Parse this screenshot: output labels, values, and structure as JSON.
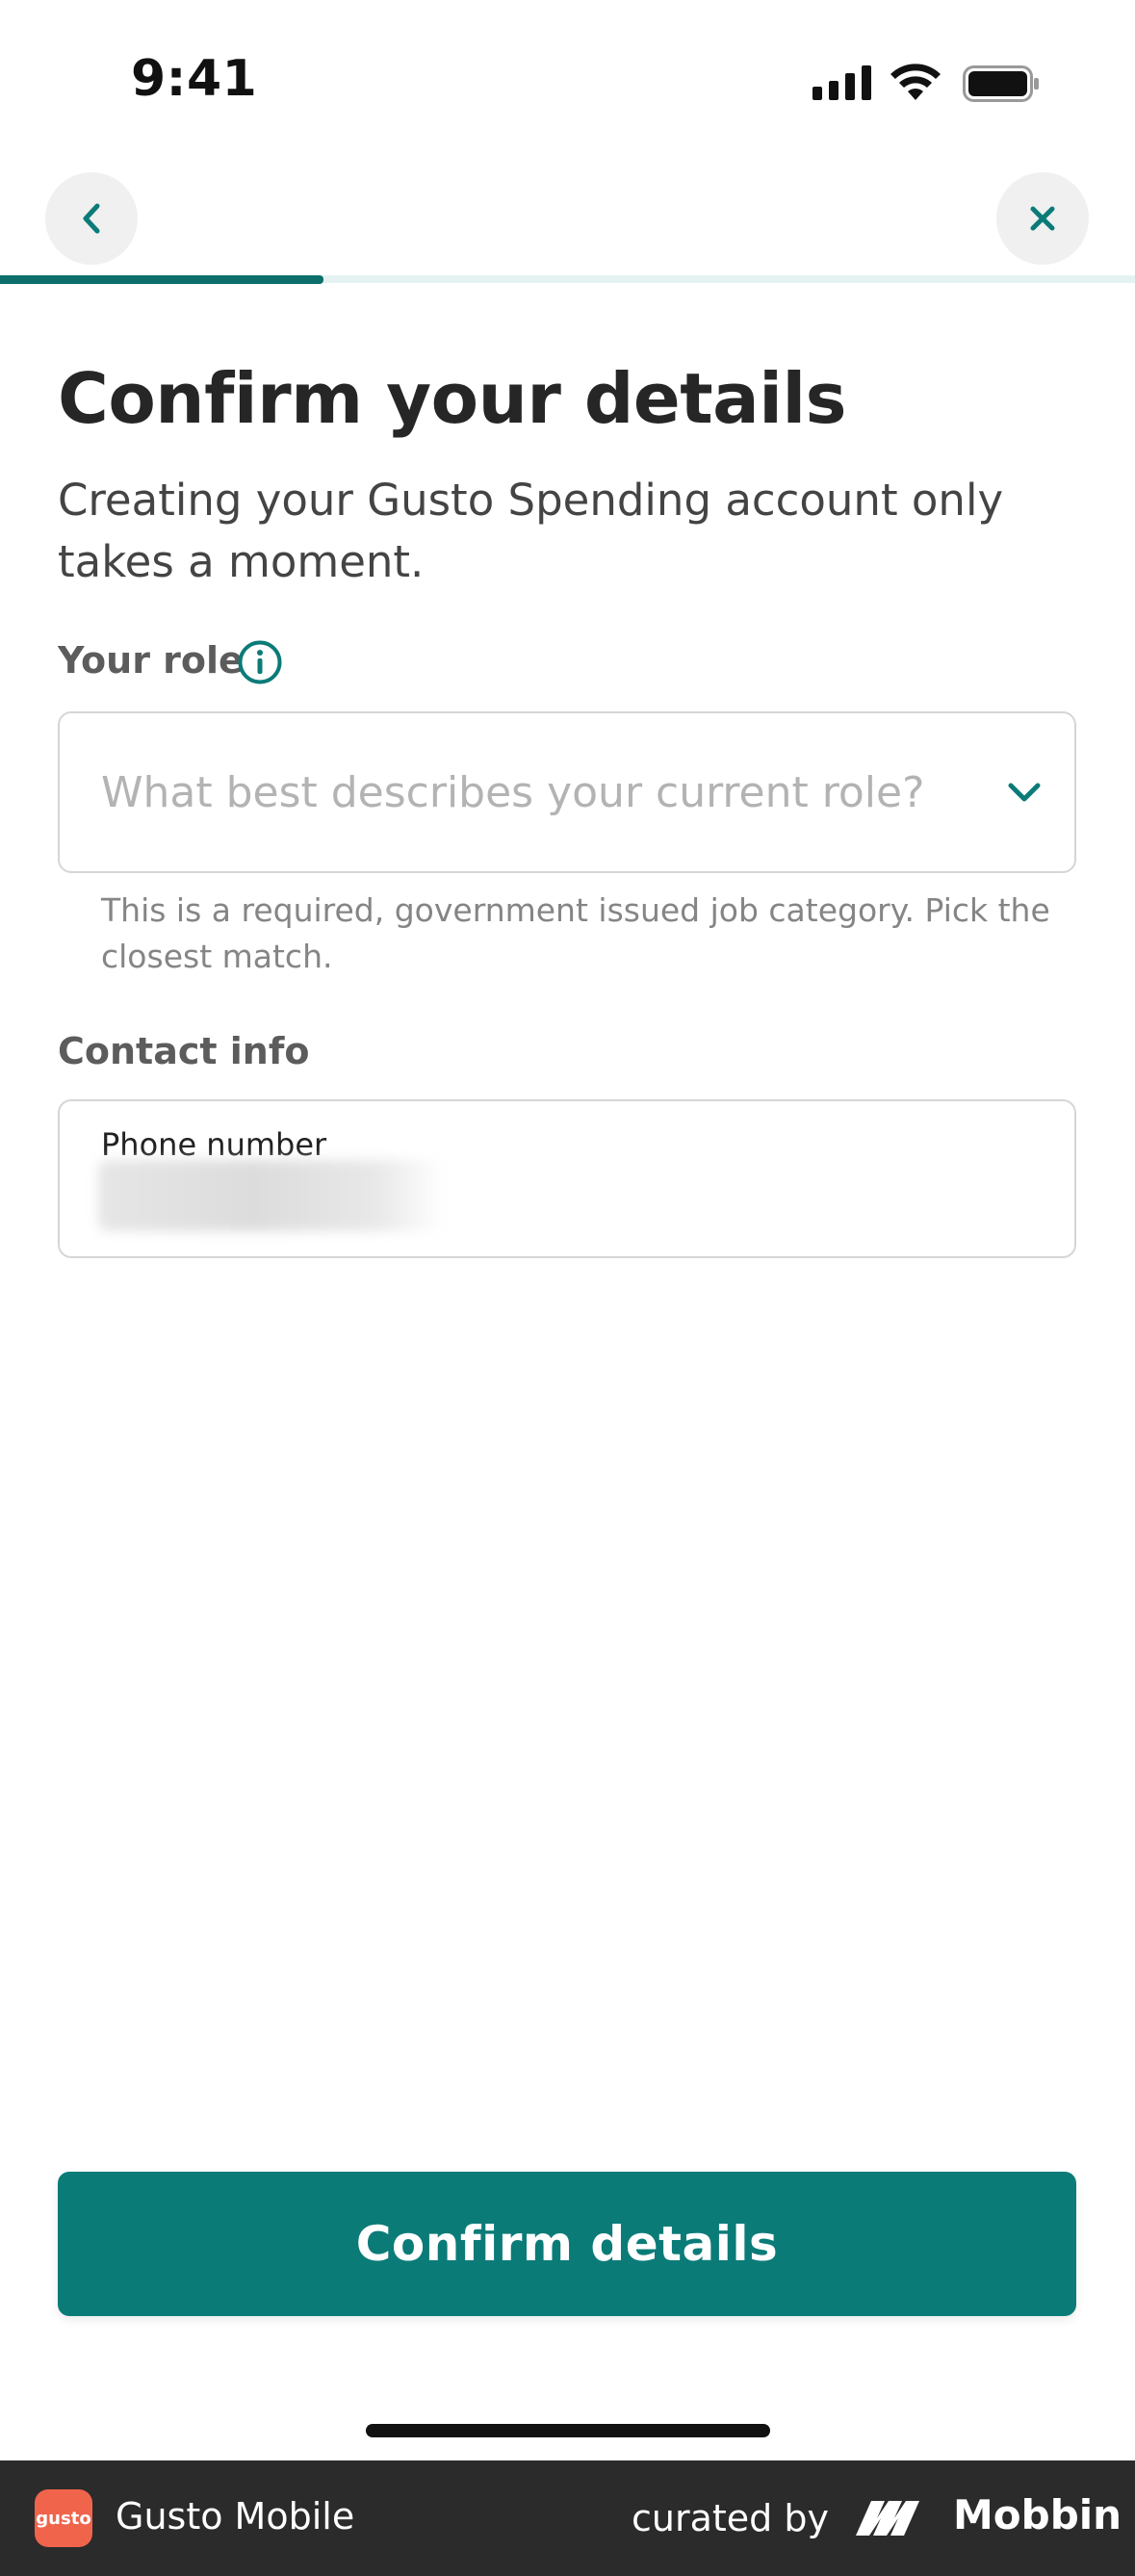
{
  "status_bar": {
    "time": "9:41",
    "icons": [
      "signal-icon",
      "wifi-icon",
      "battery-icon"
    ]
  },
  "nav": {
    "back_icon": "chevron-left-icon",
    "close_icon": "close-icon",
    "progress": 0.285
  },
  "page": {
    "title": "Confirm your details",
    "subtitle": "Creating your Gusto Spending account only takes a moment."
  },
  "role": {
    "label": "Your role",
    "info_icon": "info-icon",
    "placeholder": "What best describes your current role?",
    "helper": "This is a required, government issued job category. Pick the closest match."
  },
  "contact": {
    "label": "Contact info",
    "phone_label": "Phone number"
  },
  "actions": {
    "confirm_label": "Confirm details"
  },
  "colors": {
    "accent": "#0b7b78",
    "progress_fill": "#0c6f6c",
    "progress_track": "#e4f2f2",
    "footer_bg": "#2b2b2b",
    "logo_bg": "#f0644c"
  },
  "footer": {
    "logo_text": "gusto",
    "app_name": "Gusto Mobile",
    "curated_by": "curated by",
    "brand": "Mobbin"
  }
}
